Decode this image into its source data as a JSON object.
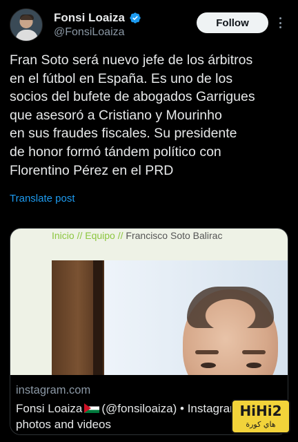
{
  "author": {
    "name": "Fonsi Loaiza",
    "handle": "@FonsiLoaiza",
    "verified": true,
    "verified_color": "#1d9bf0"
  },
  "follow_label": "Follow",
  "more_icon": "more-vertical-icon",
  "tweet_lines": [
    "Fran Soto será nuevo jefe de los árbitros",
    "en el fútbol en España. Es uno de los",
    "socios del bufete de abogados Garrigues",
    "que asesoró a Cristiano y Mourinho",
    "en sus fraudes fiscales. Su presidente",
    "de honor formó tándem político con",
    "Florentino Pérez en el PRD"
  ],
  "translate_label": "Translate post",
  "card": {
    "breadcrumb_link": "Inicio // Equipo //",
    "breadcrumb_current": "Francisco Soto Balirac",
    "domain": "instagram.com",
    "title_before_flag": "Fonsi Loaiza",
    "title_after_flag": "(@fonsiloaiza) • Instagram",
    "title_line2": "photos and videos"
  },
  "watermark": {
    "text": "HiHi2",
    "subtext": "هاي كورة"
  },
  "colors": {
    "background": "#000000",
    "text": "#e7e9ea",
    "secondary": "#8b98a5",
    "link": "#1d9bf0"
  }
}
